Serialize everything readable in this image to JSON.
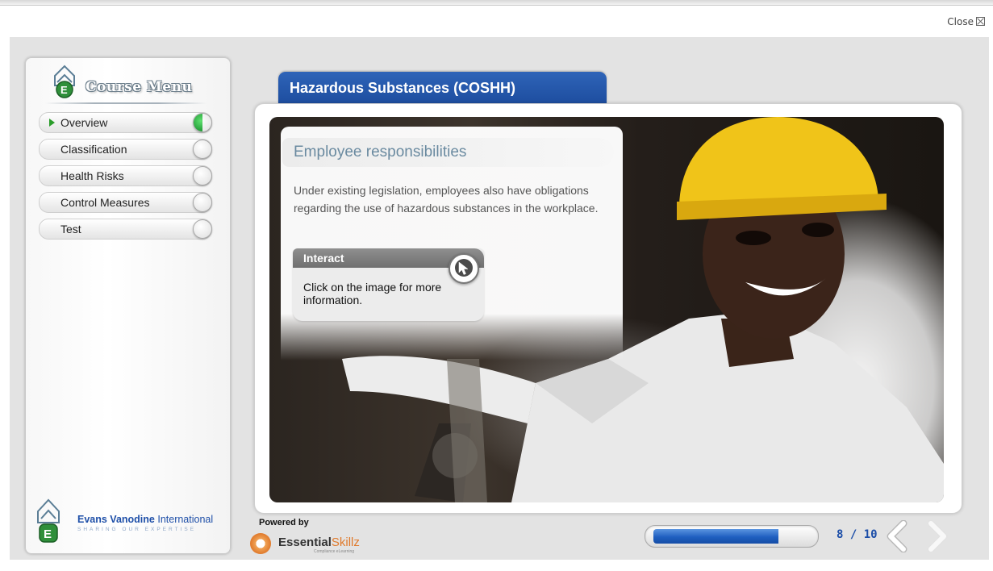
{
  "window": {
    "close_label": "Close"
  },
  "sidebar": {
    "title": "Course Menu",
    "items": [
      {
        "label": "Overview",
        "status": "in-progress",
        "current": true
      },
      {
        "label": "Classification",
        "status": "not-started",
        "current": false
      },
      {
        "label": "Health Risks",
        "status": "not-started",
        "current": false
      },
      {
        "label": "Control Measures",
        "status": "not-started",
        "current": false
      },
      {
        "label": "Test",
        "status": "not-started",
        "current": false
      }
    ],
    "brand": {
      "name_bold": "Evans Vanodine",
      "name_regular": " International",
      "tagline": "SHARING OUR EXPERTISE"
    }
  },
  "lesson": {
    "title": "Hazardous Substances (COSHH)",
    "heading": "Employee responsibilities",
    "body": "Under existing legislation, employees also have obligations regarding the use of hazardous substances in the workplace.",
    "interact": {
      "label": "Interact",
      "text": "Click on the image for more information."
    }
  },
  "footer": {
    "powered_by": "Powered by",
    "provider_bold": "Essential",
    "provider_accent": "Skillz",
    "provider_sub": "Compliance eLearning",
    "progress_fraction": 0.8,
    "page_count": "8 / 10"
  },
  "colors": {
    "accent_blue": "#1d4d9f",
    "progress_blue": "#1f5fc0",
    "status_green": "#2a9c2a",
    "provider_orange": "#e07a2c"
  },
  "icons": {
    "menu_item_arrow": "triangle-right-icon",
    "interact": "mouse-pointer-icon",
    "nav_prev": "chevron-left-icon",
    "nav_next": "chevron-right-icon",
    "close": "close-box-icon"
  }
}
